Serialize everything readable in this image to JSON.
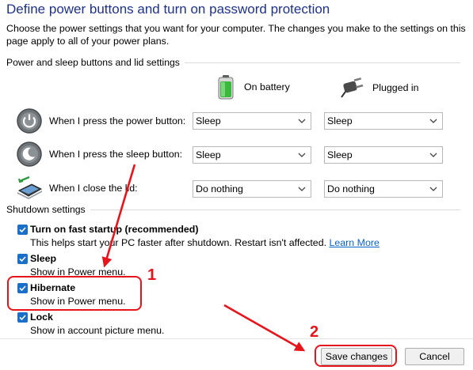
{
  "page": {
    "title": "Define power buttons and turn on password protection",
    "intro": "Choose the power settings that you want for your computer. The changes you make to the settings on this page apply to all of your power plans."
  },
  "power_section": {
    "header": "Power and sleep buttons and lid settings",
    "columns": {
      "battery": "On battery",
      "plugged": "Plugged in"
    },
    "rows": [
      {
        "label": "When I press the power button:",
        "battery": "Sleep",
        "plugged": "Sleep",
        "icon": "power-button-icon"
      },
      {
        "label": "When I press the sleep button:",
        "battery": "Sleep",
        "plugged": "Sleep",
        "icon": "sleep-button-icon"
      },
      {
        "label": "When I close the lid:",
        "battery": "Do nothing",
        "plugged": "Do nothing",
        "icon": "laptop-lid-icon"
      }
    ]
  },
  "shutdown_section": {
    "header": "Shutdown settings",
    "options": [
      {
        "title": "Turn on fast startup (recommended)",
        "desc": "This helps start your PC faster after shutdown. Restart isn't affected.",
        "link": "Learn More",
        "checked": true
      },
      {
        "title": "Sleep",
        "desc": "Show in Power menu.",
        "checked": true
      },
      {
        "title": "Hibernate",
        "desc": "Show in Power menu.",
        "checked": true
      },
      {
        "title": "Lock",
        "desc": "Show in account picture menu.",
        "checked": true
      }
    ]
  },
  "buttons": {
    "save": "Save changes",
    "cancel": "Cancel"
  },
  "annotations": {
    "step1": "1",
    "step2": "2"
  },
  "colors": {
    "accent": "#1a6fc9",
    "callout": "#e8141c",
    "title": "#1e3287"
  }
}
